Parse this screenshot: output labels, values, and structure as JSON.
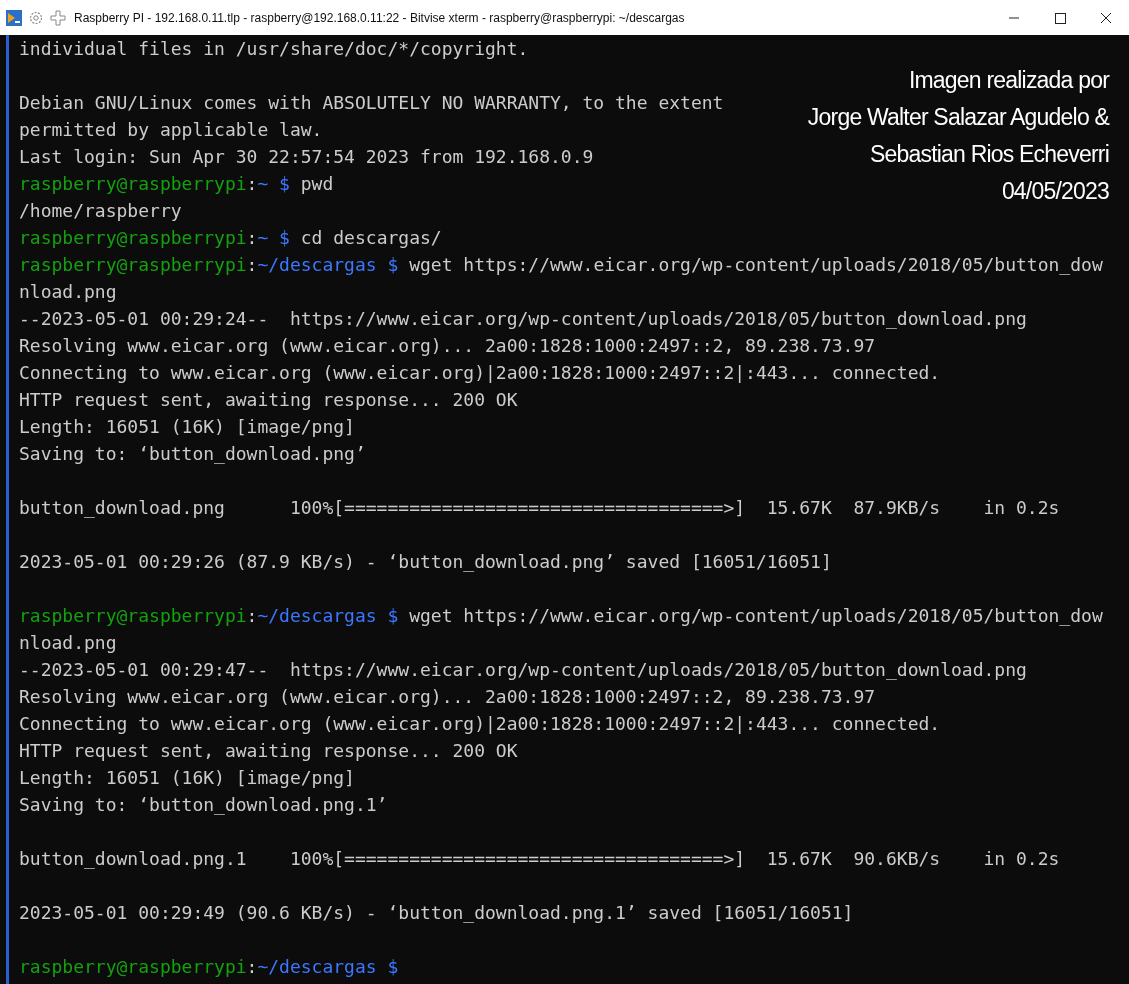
{
  "window": {
    "title": "Raspberry PI - 192.168.0.11.tlp - raspberry@192.168.0.11:22 - Bitvise xterm - raspberry@raspberrypi: ~/descargas"
  },
  "terminal": {
    "lines": [
      {
        "kind": "text",
        "text": "individual files in /usr/share/doc/*/copyright."
      },
      {
        "kind": "blank"
      },
      {
        "kind": "text",
        "text": "Debian GNU/Linux comes with ABSOLUTELY NO WARRANTY, to the extent"
      },
      {
        "kind": "text",
        "text": "permitted by applicable law."
      },
      {
        "kind": "text",
        "text": "Last login: Sun Apr 30 22:57:54 2023 from 192.168.0.9"
      },
      {
        "kind": "prompt",
        "host": "raspberry@raspberrypi",
        "separator": ":",
        "path": "~ $",
        "command": " pwd"
      },
      {
        "kind": "text",
        "text": "/home/raspberry"
      },
      {
        "kind": "prompt",
        "host": "raspberry@raspberrypi",
        "separator": ":",
        "path": "~ $",
        "command": " cd descargas/"
      },
      {
        "kind": "prompt",
        "host": "raspberry@raspberrypi",
        "separator": ":",
        "path": "~/descargas $",
        "command": " wget https://www.eicar.org/wp-content/uploads/2018/05/button_dow"
      },
      {
        "kind": "text",
        "text": "nload.png"
      },
      {
        "kind": "text",
        "text": "--2023-05-01 00:29:24--  https://www.eicar.org/wp-content/uploads/2018/05/button_download.png"
      },
      {
        "kind": "text",
        "text": "Resolving www.eicar.org (www.eicar.org)... 2a00:1828:1000:2497::2, 89.238.73.97"
      },
      {
        "kind": "text",
        "text": "Connecting to www.eicar.org (www.eicar.org)|2a00:1828:1000:2497::2|:443... connected."
      },
      {
        "kind": "text",
        "text": "HTTP request sent, awaiting response... 200 OK"
      },
      {
        "kind": "text",
        "text": "Length: 16051 (16K) [image/png]"
      },
      {
        "kind": "text",
        "text": "Saving to: ‘button_download.png’"
      },
      {
        "kind": "blank"
      },
      {
        "kind": "text",
        "text": "button_download.png      100%[===================================>]  15.67K  87.9KB/s    in 0.2s"
      },
      {
        "kind": "blank"
      },
      {
        "kind": "text",
        "text": "2023-05-01 00:29:26 (87.9 KB/s) - ‘button_download.png’ saved [16051/16051]"
      },
      {
        "kind": "blank"
      },
      {
        "kind": "prompt",
        "host": "raspberry@raspberrypi",
        "separator": ":",
        "path": "~/descargas $",
        "command": " wget https://www.eicar.org/wp-content/uploads/2018/05/button_dow"
      },
      {
        "kind": "text",
        "text": "nload.png"
      },
      {
        "kind": "text",
        "text": "--2023-05-01 00:29:47--  https://www.eicar.org/wp-content/uploads/2018/05/button_download.png"
      },
      {
        "kind": "text",
        "text": "Resolving www.eicar.org (www.eicar.org)... 2a00:1828:1000:2497::2, 89.238.73.97"
      },
      {
        "kind": "text",
        "text": "Connecting to www.eicar.org (www.eicar.org)|2a00:1828:1000:2497::2|:443... connected."
      },
      {
        "kind": "text",
        "text": "HTTP request sent, awaiting response... 200 OK"
      },
      {
        "kind": "text",
        "text": "Length: 16051 (16K) [image/png]"
      },
      {
        "kind": "text",
        "text": "Saving to: ‘button_download.png.1’"
      },
      {
        "kind": "blank"
      },
      {
        "kind": "text",
        "text": "button_download.png.1    100%[===================================>]  15.67K  90.6KB/s    in 0.2s"
      },
      {
        "kind": "blank"
      },
      {
        "kind": "text",
        "text": "2023-05-01 00:29:49 (90.6 KB/s) - ‘button_download.png.1’ saved [16051/16051]"
      },
      {
        "kind": "blank"
      },
      {
        "kind": "prompt",
        "host": "raspberry@raspberrypi",
        "separator": ":",
        "path": "~/descargas $"
      }
    ]
  },
  "overlay_caption": [
    "Imagen realizada por",
    "Jorge Walter Salazar Agudelo &",
    "Sebastian Rios Echeverri",
    "04/05/2023"
  ]
}
